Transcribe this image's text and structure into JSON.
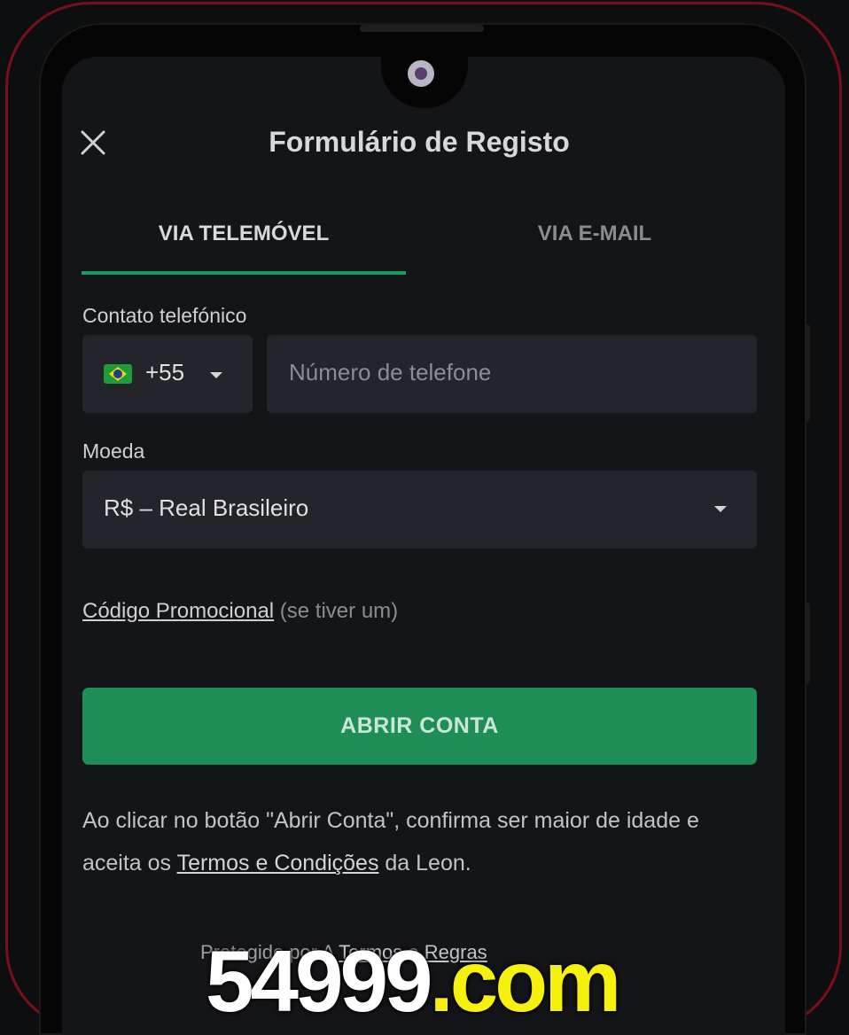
{
  "header": {
    "title": "Formulário de Registo",
    "close_icon": "close-icon"
  },
  "tabs": [
    {
      "label": "VIA TELEMÓVEL",
      "active": true
    },
    {
      "label": "VIA E-MAIL",
      "active": false
    }
  ],
  "phone": {
    "label": "Contato telefónico",
    "country_flag": "brazil-flag-icon",
    "dial_code": "+55",
    "placeholder": "Número de telefone",
    "value": ""
  },
  "currency": {
    "label": "Moeda",
    "selected": "R$ – Real Brasileiro"
  },
  "promo": {
    "link": "Código Promocional",
    "hint": "(se tiver um)"
  },
  "submit": {
    "label": "ABRIR CONTA"
  },
  "legal": {
    "prefix": "Ao clicar no botão \"Abrir Conta\", confirma ser maior de idade e aceita os ",
    "link": "Termos e Condições",
    "suffix": " da Leon."
  },
  "footer": {
    "prefix": "Protegido por ",
    "mid": "A ",
    "terms": "Termos",
    "and": " e ",
    "rules": "Regras"
  },
  "watermark": {
    "number": "54999",
    "domain": ".com"
  },
  "colors": {
    "accent": "#1e9a5e",
    "button": "#1e8e56",
    "frame": "#7a0f1c",
    "watermark_domain": "#f5f10d"
  }
}
